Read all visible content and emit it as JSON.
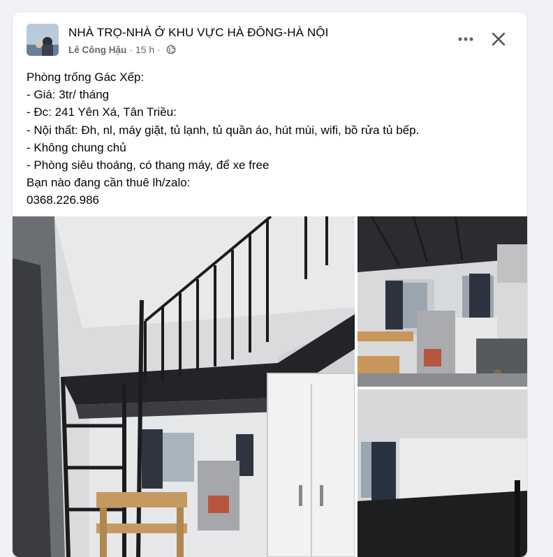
{
  "post": {
    "group_name": "NHÀ TRỌ-NHÀ Ở KHU VỰC HÀ ĐÔNG-HÀ NỘI",
    "author": "Lê Công Hậu",
    "separator": "·",
    "time": "15 h",
    "privacy_icon": "globe-icon",
    "more_icon": "more-options-icon",
    "close_icon": "close-icon",
    "lines": [
      "Phòng trống Gác Xếp:",
      "- Giá: 3tr/ tháng",
      "- Đc: 241 Yên Xá, Tân Triều:",
      "- Nội thất: Đh, nl, máy giặt, tủ lạnh, tủ quần áo, hút mùi, wifi, bồ rửa tủ bếp.",
      "- Không chung chủ",
      "- Phòng siêu thoáng, có thang máy, để xe free",
      "Bạn nào đang cần thuê lh/zalo:",
      "0368.226.986"
    ]
  },
  "colors": {
    "page_bg": "#f0f2f5",
    "card_bg": "#ffffff",
    "text_primary": "#050505",
    "text_secondary": "#65676b"
  }
}
